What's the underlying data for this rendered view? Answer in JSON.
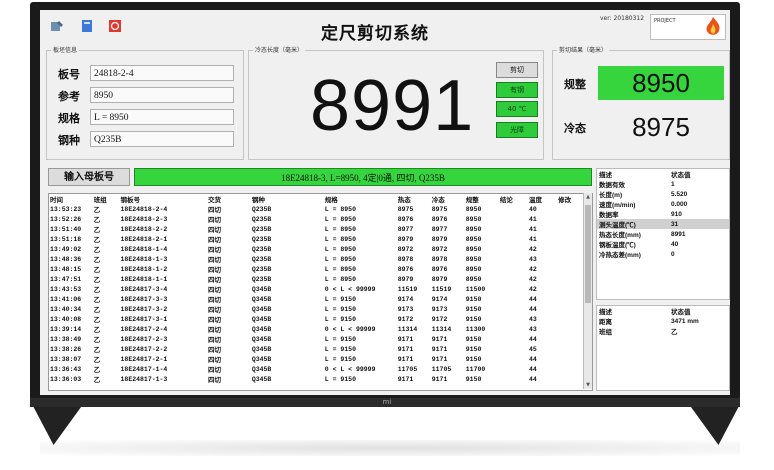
{
  "header": {
    "title": "定尺剪切系统",
    "version": "ver: 20180312",
    "brand_text": "PROJECT"
  },
  "plate_info": {
    "group_title": "板坯信息",
    "fields": [
      {
        "label": "板号",
        "value": "24818-2-4"
      },
      {
        "label": "参考",
        "value": "8950"
      },
      {
        "label": "规格",
        "value": "L = 8950"
      },
      {
        "label": "钢种",
        "value": "Q235B"
      }
    ]
  },
  "cold_length": {
    "group_title": "冷态长度（毫米）",
    "value": "8991"
  },
  "buttons": {
    "cut": "剪切",
    "ok": "有钢",
    "temp": "40 ℃",
    "light": "光障"
  },
  "cut_result": {
    "group_title": "剪切结果（毫米）",
    "label_setting": "规整",
    "value_setting": "8950",
    "label_cold": "冷态",
    "value_cold": "8975"
  },
  "input_bar": {
    "button_label": "输入母板号",
    "info_text": "18E24818-3, L=8950, 4定|0通, 四切, Q235B"
  },
  "log": {
    "columns": [
      "时间",
      "班组",
      "钢板号",
      "交货",
      "钢种",
      "规格",
      "热态",
      "冷态",
      "规整",
      "结论",
      "温度",
      "修改"
    ],
    "rows": [
      [
        "13:53:23",
        "乙",
        "18E24818-2-4",
        "四切",
        "Q235B",
        "L = 8950",
        "8975",
        "8975",
        "8950",
        "",
        "40",
        ""
      ],
      [
        "13:52:26",
        "乙",
        "18E24818-2-3",
        "四切",
        "Q235B",
        "L = 8950",
        "8976",
        "8976",
        "8950",
        "",
        "41",
        ""
      ],
      [
        "13:51:40",
        "乙",
        "18E24818-2-2",
        "四切",
        "Q235B",
        "L = 8950",
        "8977",
        "8977",
        "8950",
        "",
        "41",
        ""
      ],
      [
        "13:51:18",
        "乙",
        "18E24818-2-1",
        "四切",
        "Q235B",
        "L = 8950",
        "8979",
        "8979",
        "8950",
        "",
        "41",
        ""
      ],
      [
        "13:49:02",
        "乙",
        "18E24818-1-4",
        "四切",
        "Q235B",
        "L = 8950",
        "8972",
        "8972",
        "8950",
        "",
        "42",
        ""
      ],
      [
        "13:48:36",
        "乙",
        "18E24818-1-3",
        "四切",
        "Q235B",
        "L = 8950",
        "8978",
        "8978",
        "8950",
        "",
        "43",
        ""
      ],
      [
        "13:48:15",
        "乙",
        "18E24818-1-2",
        "四切",
        "Q235B",
        "L = 8950",
        "8976",
        "8976",
        "8950",
        "",
        "42",
        ""
      ],
      [
        "13:47:51",
        "乙",
        "18E24818-1-1",
        "四切",
        "Q235B",
        "L = 8950",
        "8979",
        "8979",
        "8950",
        "",
        "42",
        ""
      ],
      [
        "13:43:53",
        "乙",
        "18E24817-3-4",
        "四切",
        "Q345B",
        "0 < L < 99999",
        "11519",
        "11519",
        "11500",
        "",
        "42",
        ""
      ],
      [
        "13:41:06",
        "乙",
        "18E24817-3-3",
        "四切",
        "Q345B",
        "L = 9150",
        "9174",
        "9174",
        "9150",
        "",
        "44",
        ""
      ],
      [
        "13:40:34",
        "乙",
        "18E24817-3-2",
        "四切",
        "Q345B",
        "L = 9150",
        "9173",
        "9173",
        "9150",
        "",
        "44",
        ""
      ],
      [
        "13:40:08",
        "乙",
        "18E24817-3-1",
        "四切",
        "Q345B",
        "L = 9150",
        "9172",
        "9172",
        "9150",
        "",
        "43",
        ""
      ],
      [
        "13:39:14",
        "乙",
        "18E24817-2-4",
        "四切",
        "Q345B",
        "0 < L < 99999",
        "11314",
        "11314",
        "11300",
        "",
        "43",
        ""
      ],
      [
        "13:38:49",
        "乙",
        "18E24817-2-3",
        "四切",
        "Q345B",
        "L = 9150",
        "9171",
        "9171",
        "9150",
        "",
        "44",
        ""
      ],
      [
        "13:38:26",
        "乙",
        "18E24817-2-2",
        "四切",
        "Q345B",
        "L = 9150",
        "9171",
        "9171",
        "9150",
        "",
        "45",
        ""
      ],
      [
        "13:38:07",
        "乙",
        "18E24817-2-1",
        "四切",
        "Q345B",
        "L = 9150",
        "9171",
        "9171",
        "9150",
        "",
        "44",
        ""
      ],
      [
        "13:36:43",
        "乙",
        "18E24817-1-4",
        "四切",
        "Q345B",
        "0 < L < 99999",
        "11705",
        "11705",
        "11700",
        "",
        "44",
        ""
      ],
      [
        "13:36:03",
        "乙",
        "18E24817-1-3",
        "四切",
        "Q345B",
        "L = 9150",
        "9171",
        "9171",
        "9150",
        "",
        "44",
        ""
      ]
    ]
  },
  "status_top": {
    "columns": [
      "描述",
      "状态值"
    ],
    "rows": [
      [
        "数据有效",
        "1"
      ],
      [
        "长度(m)",
        "5.520"
      ],
      [
        "速度(m/min)",
        "0.000"
      ],
      [
        "数据率",
        "910"
      ],
      [
        "测头温度(℃)",
        "31"
      ],
      [
        "热态长度(mm)",
        "8991"
      ],
      [
        "钢板温度(℃)",
        "40"
      ],
      [
        "冷热态差(mm)",
        "0"
      ]
    ],
    "highlight_index": 4
  },
  "status_bottom": {
    "columns": [
      "描述",
      "状态值"
    ],
    "rows": [
      [
        "距离",
        "3471 mm"
      ],
      [
        "班组",
        "乙"
      ]
    ]
  },
  "tv": {
    "logo": "mi"
  }
}
